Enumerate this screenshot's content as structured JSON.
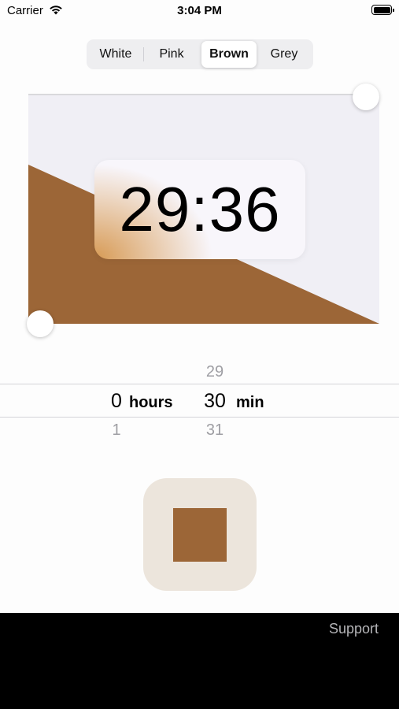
{
  "status_bar": {
    "carrier": "Carrier",
    "time": "3:04 PM",
    "battery_level": 1.0
  },
  "color_picker": {
    "options": [
      "White",
      "Pink",
      "Brown",
      "Grey"
    ],
    "selected": "Brown"
  },
  "timer": {
    "display": "29:36"
  },
  "picker": {
    "hours": {
      "above": "",
      "selected": "0",
      "below": "1",
      "unit": "hours"
    },
    "minutes": {
      "above": "29",
      "selected": "30",
      "below": "31",
      "unit": "min"
    }
  },
  "footer": {
    "support_label": "Support"
  },
  "colors": {
    "accent_brown": "#9c6637",
    "canvas_bg": "#f0eff5",
    "stop_bg": "#ece5dc"
  }
}
